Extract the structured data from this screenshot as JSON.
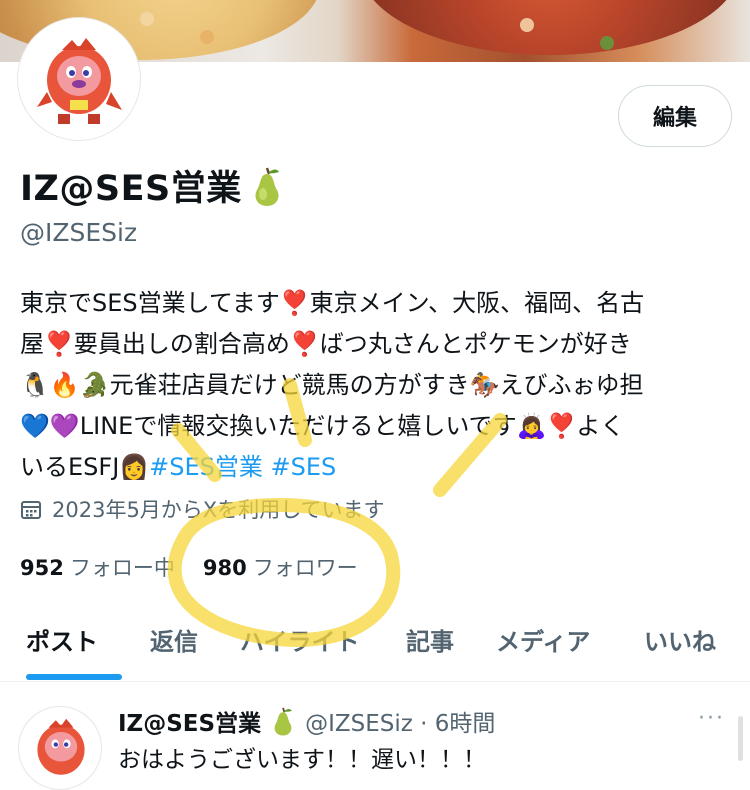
{
  "profile": {
    "name": "IZ@SES営業",
    "handle": "@IZSESiz",
    "edit_label": "編集",
    "bio_lines": [
      [
        "東京でSES営業してます",
        "❣️",
        "東京メイン、大阪、福岡、名古"
      ],
      [
        "屋",
        "❣️",
        "要員出しの割合高め",
        "❣️",
        "ばつ丸さんとポケモンが好き"
      ],
      [
        "🐧🔥🐊",
        "元雀荘店員だけど競馬の方がすき",
        "🏇",
        "えびふぉゆ担"
      ],
      [
        "💙💜",
        "LINEで情報交換いただけると嬉しいです",
        "🙇‍♀️",
        "❣️",
        "よく"
      ],
      [
        "いるESFJ",
        "👩",
        "#SES営業 #SES"
      ]
    ],
    "joined_text": "2023年5月からXを利用しています",
    "following_count": "952",
    "following_label": "フォロー中",
    "followers_count": "980",
    "followers_label": "フォロワー"
  },
  "tabs": [
    "ポスト",
    "返信",
    "ハイライト",
    "記事",
    "メディア",
    "いいね"
  ],
  "post": {
    "name": "IZ@SES営業",
    "handle_time": "@IZSESiz · 6時間",
    "more": "···",
    "text": "おはようございます！！遅い！！！"
  },
  "colors": {
    "accent": "#1d9bf0",
    "secondary_text": "#536471",
    "annotation": "#f5d63a"
  },
  "icons": {
    "pear": "pear-icon",
    "calendar": "calendar-icon"
  }
}
